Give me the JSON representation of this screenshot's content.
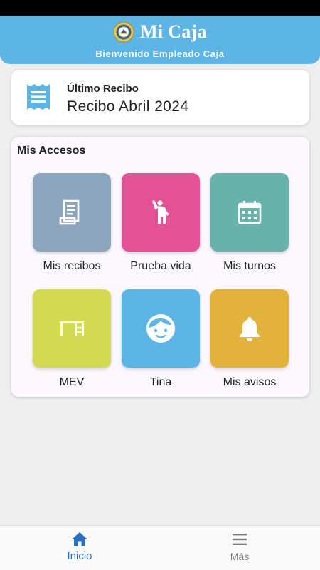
{
  "header": {
    "title": "Mi Caja",
    "subtitle": "Bienvenido Empleado Caja"
  },
  "receipt": {
    "label": "Último Recibo",
    "value": "Recibo Abril 2024",
    "icon": "receipt-icon"
  },
  "access": {
    "title": "Mis Accesos",
    "tiles": [
      {
        "label": "Mis recibos",
        "icon": "document-icon",
        "color": "#8ca7bd"
      },
      {
        "label": "Prueba vida",
        "icon": "person-waving-icon",
        "color": "#e35296"
      },
      {
        "label": "Mis turnos",
        "icon": "calendar-icon",
        "color": "#67b3ac"
      },
      {
        "label": "MEV",
        "icon": "desk-icon",
        "color": "#d2db4f"
      },
      {
        "label": "Tina",
        "icon": "face-icon",
        "color": "#5db4e6"
      },
      {
        "label": "Mis avisos",
        "icon": "bell-icon",
        "color": "#e2b23a"
      }
    ]
  },
  "nav": {
    "home_label": "Inicio",
    "more_label": "Más",
    "active_color": "#2a6fc4",
    "inactive_color": "#7d7d7d"
  },
  "colors": {
    "header": "#5db4e6",
    "background": "#efefef"
  }
}
